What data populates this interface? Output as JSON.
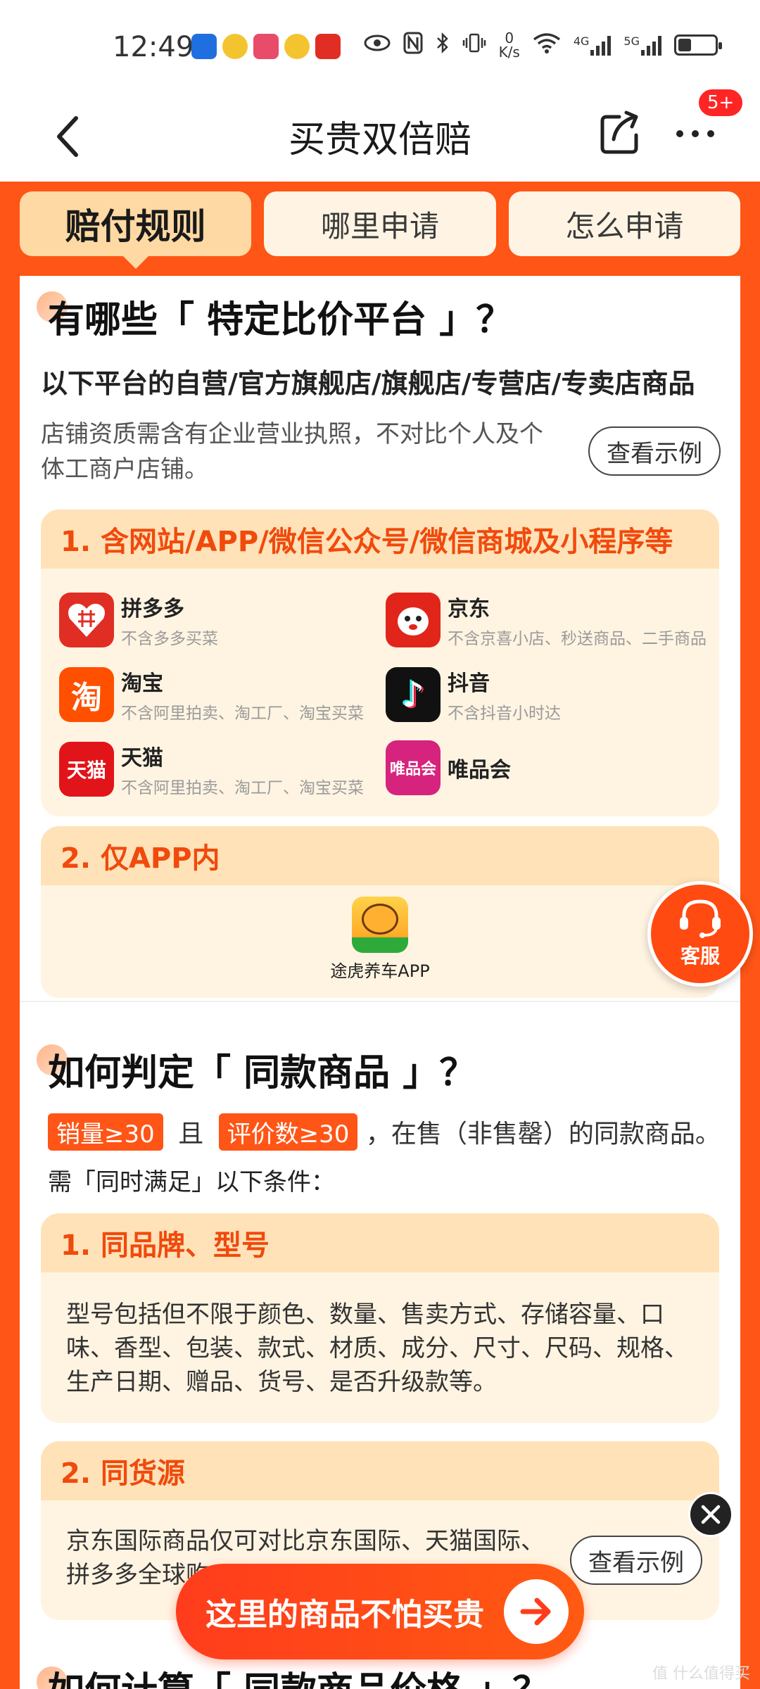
{
  "status_bar": {
    "time": "12:49",
    "net_speed": "0\nK/s",
    "sig1": "4G",
    "sig2": "5G"
  },
  "nav": {
    "title": "买贵双倍赔",
    "badge": "5+"
  },
  "tabs": [
    {
      "label": "赔付规则",
      "active": true
    },
    {
      "label": "哪里申请",
      "active": false
    },
    {
      "label": "怎么申请",
      "active": false
    }
  ],
  "section1": {
    "title": "有哪些「 特定比价平台 」？",
    "subtitle": "以下平台的自营/官方旗舰店/旗舰店/专营店/专卖店商品",
    "note_line1": "店铺资质需含有企业营业执照，不对比个人及个",
    "note_line2": "体工商户店铺。",
    "example_button": "查看示例",
    "card1": {
      "header": "1. 含网站/APP/微信公众号/微信商城及小程序等",
      "platforms": [
        {
          "name": "拼多多",
          "desc": "不含多多买菜",
          "color": "#e02e24",
          "icon": "pinduoduo-icon"
        },
        {
          "name": "京东",
          "desc": "不含京喜小店、秒送商品、二手商品",
          "color": "#e1251b",
          "icon": "jd-icon"
        },
        {
          "name": "淘宝",
          "desc": "不含阿里拍卖、淘工厂、淘宝买菜",
          "color": "#ff5000",
          "icon": "taobao-icon",
          "glyph": "淘"
        },
        {
          "name": "抖音",
          "desc": "不含抖音小时达",
          "color": "#111111",
          "icon": "douyin-icon",
          "glyph": "♪"
        },
        {
          "name": "天猫",
          "desc": "不含阿里拍卖、淘工厂、淘宝买菜",
          "color": "#e1141a",
          "icon": "tmall-icon",
          "glyph": "天猫"
        },
        {
          "name": "唯品会",
          "desc": "",
          "color": "#d6237e",
          "icon": "vipshop-icon",
          "glyph": "唯品会"
        }
      ]
    },
    "card2": {
      "header": "2. 仅APP内",
      "app_name": "途虎养车APP"
    }
  },
  "section2": {
    "title": "如何判定「 同款商品 」？",
    "tag1": "销量≥30",
    "and_text": "且",
    "tag2": "评价数≥30",
    "line1_rest": "，在售（非售罄）的同款商品。",
    "line2": "需「同时满足」以下条件：",
    "card1": {
      "header": "1. 同品牌、型号",
      "body": "型号包括但不限于颜色、数量、售卖方式、存储容量、口味、香型、包装、款式、材质、成分、尺寸、尺码、规格、生产日期、赠品、货号、是否升级款等。"
    },
    "card2": {
      "header": "2. 同货源",
      "body_line1": "京东国际商品仅可对比京东国际、天猫国际、",
      "body_line2": "拼多多全球购",
      "example_button": "查看示例"
    }
  },
  "section3": {
    "title": "如何计算「 同款商品价格 」？"
  },
  "floating": {
    "customer_service": "客服",
    "cta": "这里的商品不怕买贵"
  },
  "watermark": "值 什么值得买"
}
